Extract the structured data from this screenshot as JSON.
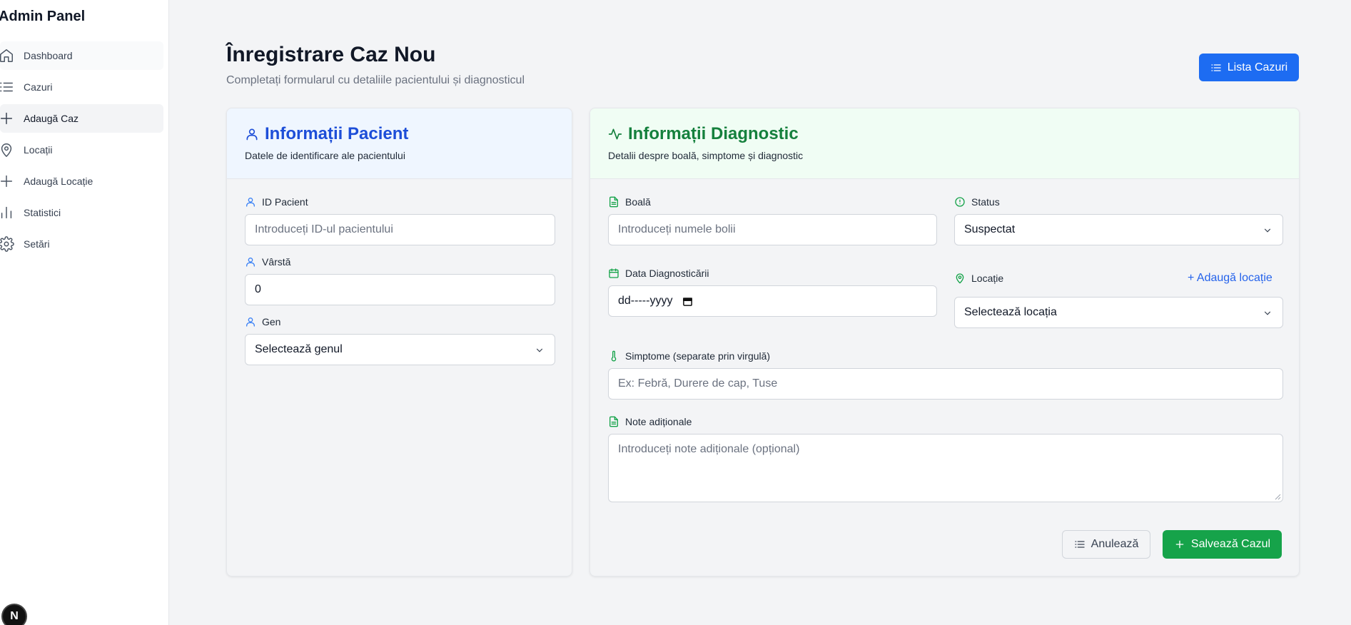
{
  "sidebar": {
    "brand": "Admin Panel",
    "items": [
      {
        "label": "Dashboard",
        "icon": "home-icon"
      },
      {
        "label": "Cazuri",
        "icon": "list-icon"
      },
      {
        "label": "Adaugă Caz",
        "icon": "plus-icon"
      },
      {
        "label": "Locații",
        "icon": "map-pin-icon"
      },
      {
        "label": "Adaugă Locație",
        "icon": "plus-icon"
      },
      {
        "label": "Statistici",
        "icon": "bar-chart-icon"
      },
      {
        "label": "Setări",
        "icon": "gear-icon"
      }
    ],
    "badge": "N"
  },
  "header": {
    "title": "Înregistrare Caz Nou",
    "subtitle": "Completați formularul cu detaliile pacientului și diagnosticul",
    "list_button": "Lista Cazuri"
  },
  "patient": {
    "title": "Informații Pacient",
    "description": "Datele de identificare ale pacientului",
    "id_label": "ID Pacient",
    "id_placeholder": "Introduceți ID-ul pacientului",
    "age_label": "Vârstă",
    "age_value": "0",
    "gender_label": "Gen",
    "gender_value": "Selectează genul"
  },
  "diagnostic": {
    "title": "Informații Diagnostic",
    "description": "Detalii despre boală, simptome și diagnostic",
    "disease_label": "Boală",
    "disease_placeholder": "Introduceți numele bolii",
    "status_label": "Status",
    "status_value": "Suspectat",
    "date_label": "Data Diagnosticării",
    "date_value": "dd-----yyyy",
    "location_label": "Locație",
    "add_location": "+ Adaugă locație",
    "location_value": "Selectează locația",
    "symptoms_label": "Simptome (separate prin virgulă)",
    "symptoms_placeholder": "Ex: Febră, Durere de cap, Tuse",
    "notes_label": "Note adiționale",
    "notes_placeholder": "Introduceți note adiționale (opțional)",
    "cancel_button": "Anulează",
    "save_button": "Salvează Cazul"
  },
  "colors": {
    "primary": "#1d6cf2",
    "success": "#16a34a",
    "patient_accent": "#1d4ed8",
    "diagnostic_accent": "#15803d"
  }
}
